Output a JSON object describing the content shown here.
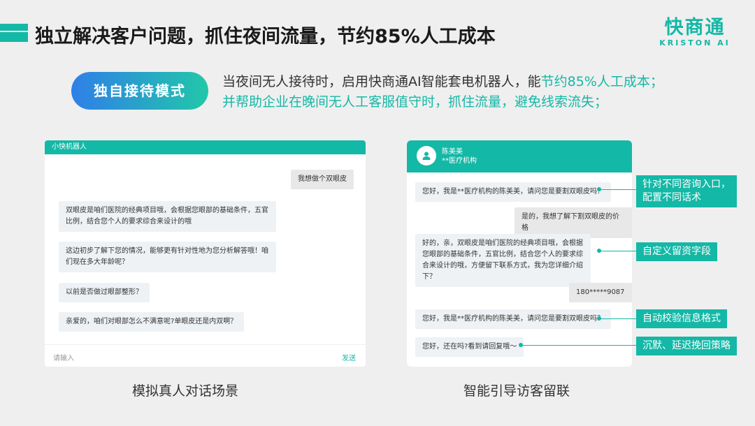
{
  "header": {
    "title": "独立解决客户问题，抓住夜间流量，节约85%人工成本",
    "logo_cn": "快商通",
    "logo_en": "KRISTON AI"
  },
  "mode": {
    "label": "独自接待模式",
    "line1_pre": "当夜间无人接待时，启用快商通AI智能套电机器人，能",
    "line1_highlight": "节约85%人工成本；",
    "line2": "并帮助企业在晚间无人工客服值守时，抓住流量，避免线索流失；"
  },
  "left_chat": {
    "title": "小快机器人",
    "messages": [
      {
        "from": "user",
        "text": "我想做个双眼皮"
      },
      {
        "from": "bot",
        "text": "双眼皮是咱们医院的经典项目哦，会根据您眼部的基础条件，五官比例，结合您个人的要求综合来设计的哦"
      },
      {
        "from": "bot",
        "text": "这边初步了解下您的情况，能够更有针对性地为您分析解答哦！咱们现在多大年龄呢？"
      },
      {
        "from": "bot",
        "text": "以前是否做过眼部整形？"
      },
      {
        "from": "bot",
        "text": "亲爱的，咱们对眼部怎么不满意呢?单眼皮还是内双啊？"
      }
    ],
    "input_placeholder": "请输入",
    "send_label": "发送",
    "caption": "模拟真人对话场景"
  },
  "right_chat": {
    "agent_name": "陈美美",
    "agent_org": "**医疗机构",
    "messages": [
      {
        "from": "bot",
        "text": "您好，我是**医疗机构的陈美美，请问您是要割双眼皮吗？"
      },
      {
        "from": "user",
        "text": "是的，我想了解下割双眼皮的价格"
      },
      {
        "from": "bot",
        "text": "好的，亲，双眼皮是咱们医院的经典项目哦，会根据您眼部的基础条件，五官比例，结合您个人的要求综合来设计的哦，方便留下联系方式，我为您详细介绍下？"
      },
      {
        "from": "user",
        "text": "180*****9087"
      },
      {
        "from": "bot",
        "text": "您好，我是**医疗机构的陈美美，请问您是要割双眼皮吗？"
      },
      {
        "from": "bot",
        "text": "您好，还在吗?看到请回复哦～"
      }
    ],
    "caption": "智能引导访客留联"
  },
  "annotations": [
    "针对不同咨询入口，\n配置不同话术",
    "自定义留资字段",
    "自动校验信息格式",
    "沉默、延迟挽回策略"
  ],
  "colors": {
    "accent": "#14b8a6",
    "pill_start": "#2f7fe8",
    "pill_end": "#22c7a9",
    "background": "#efefef"
  }
}
